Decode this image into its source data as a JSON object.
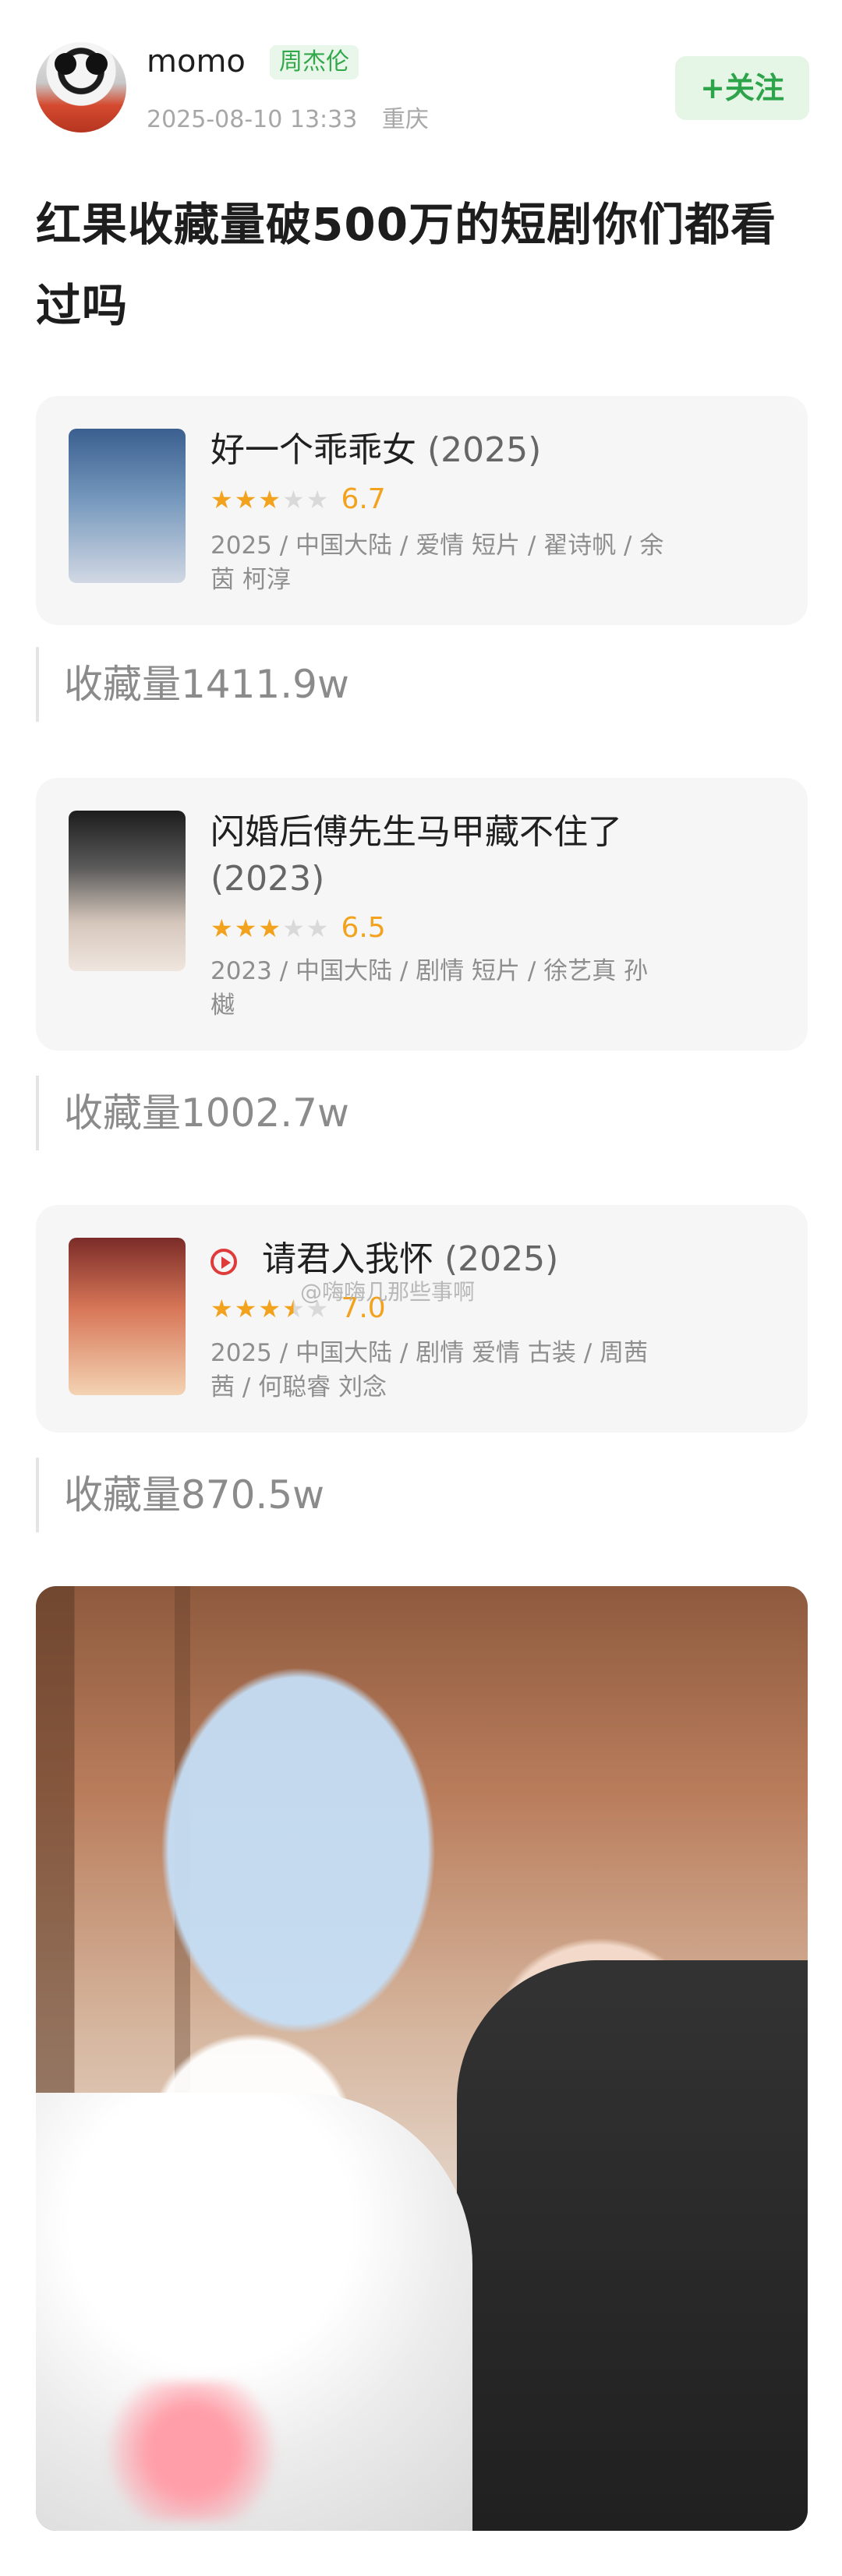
{
  "header": {
    "username": "momo",
    "tag": "周杰伦",
    "time": "2025-08-10 13:33",
    "location": "重庆",
    "follow": "+关注"
  },
  "post": {
    "title": "红果收藏量破500万的短剧你们都看过吗"
  },
  "cards": [
    {
      "title": "好一个乖乖女",
      "year": "(2025)",
      "score": "6.7",
      "rating_stars": 3,
      "info": "2025 / 中国大陆 / 爱情 短片 / 翟诗帆 / 余茵 柯淳",
      "favorites": "收藏量1411.9w"
    },
    {
      "title": "闪婚后傅先生马甲藏不住了",
      "year": "(2023)",
      "score": "6.5",
      "rating_stars": 3,
      "info": "2023 / 中国大陆 / 剧情 短片 / 徐艺真 孙樾",
      "favorites": "收藏量1002.7w"
    },
    {
      "title": "请君入我怀",
      "year": "(2025)",
      "score": "7.0",
      "rating_stars": 3.5,
      "info": "2025 / 中国大陆 / 剧情 爱情 古装 / 周茜茜 / 何聪睿 刘念",
      "favorites": "收藏量870.5w"
    }
  ],
  "watermark": "@嗨嗨几那些事啊",
  "colors": {
    "accent": "#2ea44a",
    "star": "#f2a21c",
    "card_background": "#f6f6f6"
  }
}
